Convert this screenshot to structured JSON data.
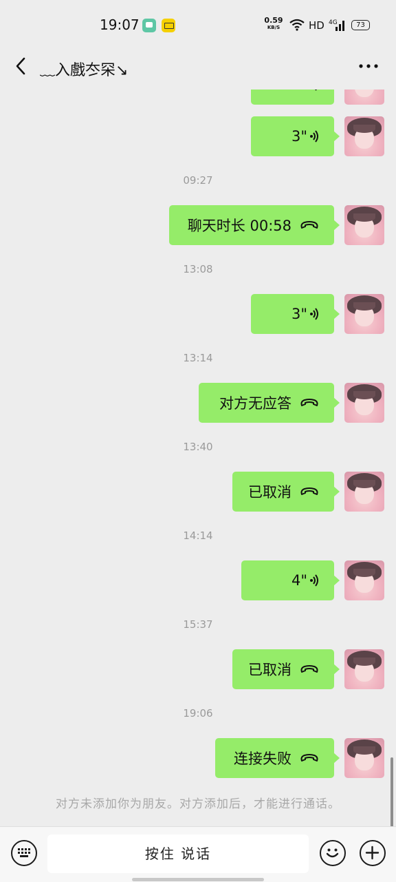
{
  "status_bar": {
    "time": "19:07",
    "net_speed": "0.59",
    "net_speed_unit": "KB/S",
    "hd": "HD",
    "network": "4G",
    "battery": "73"
  },
  "header": {
    "title": "﹏入戲冭罙↘"
  },
  "messages": [
    {
      "type": "voice",
      "text": "",
      "duration": ""
    },
    {
      "type": "voice",
      "text": "3\"",
      "duration": "3\""
    },
    {
      "type": "timestamp",
      "text": "09:27"
    },
    {
      "type": "call",
      "text": "聊天时长 00:58"
    },
    {
      "type": "timestamp",
      "text": "13:08"
    },
    {
      "type": "voice",
      "text": "3\""
    },
    {
      "type": "timestamp",
      "text": "13:14"
    },
    {
      "type": "call",
      "text": "对方无应答"
    },
    {
      "type": "timestamp",
      "text": "13:40"
    },
    {
      "type": "call",
      "text": "已取消"
    },
    {
      "type": "timestamp",
      "text": "14:14"
    },
    {
      "type": "voice",
      "text": "4\""
    },
    {
      "type": "timestamp",
      "text": "15:37"
    },
    {
      "type": "call",
      "text": "已取消"
    },
    {
      "type": "timestamp",
      "text": "19:06"
    },
    {
      "type": "call",
      "text": "连接失败"
    }
  ],
  "notice": "对方未添加你为朋友。对方添加后，才能进行通话。",
  "bottom_bar": {
    "hold_to_talk": "按住 说话"
  },
  "colors": {
    "bubble": "#95ec69",
    "background": "#ededed",
    "timestamp": "#9a9a9a"
  }
}
